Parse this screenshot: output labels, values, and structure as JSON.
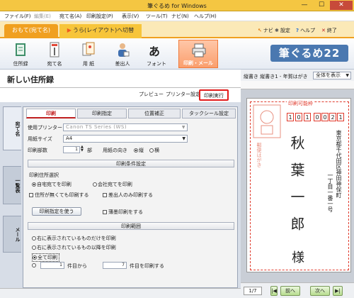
{
  "window": {
    "title": "筆ぐるめ for Windows",
    "min": "—",
    "max": "☐",
    "close": "✕"
  },
  "menu": [
    {
      "label": "ファイル(F)",
      "enabled": true
    },
    {
      "label": "編集(E)",
      "enabled": false
    },
    {
      "label": "宛て名(A)",
      "enabled": true
    },
    {
      "label": "印刷設定(P)",
      "enabled": true
    },
    {
      "label": "表示(V)",
      "enabled": true
    },
    {
      "label": "ツール(T)",
      "enabled": true
    },
    {
      "label": "ナビ(N)",
      "enabled": true
    },
    {
      "label": "ヘルプ(H)",
      "enabled": true
    }
  ],
  "mode": {
    "front": "おもて(宛て名)",
    "back": "うら(レイアウト)へ切替",
    "back_arrow": "▶"
  },
  "help": {
    "navi": "ナビ",
    "settings": "設定",
    "help": "ヘルプ",
    "exit": "終了"
  },
  "toolbar": {
    "address_book": "住所録",
    "address_name": "宛て名",
    "paper": "用 紙",
    "sender": "差出人",
    "font": "フォント",
    "print_mail": "印刷・メール"
  },
  "logo": "筆ぐるめ22",
  "page_title": "新しい住所録",
  "actions": {
    "preview": "プレビュー",
    "printer_settings": "プリンター設定",
    "print_execute": "印刷実行"
  },
  "side_tabs": {
    "address": "宛て名",
    "list": "一覧表",
    "mail": "メール"
  },
  "dialog": {
    "tabs": {
      "print": "印刷",
      "print_spec": "印刷指定",
      "position": "位置補正",
      "tack_seal": "タックシール設定"
    },
    "printer_label": "使用プリンター",
    "printer_value": "Canon TS Series (WS)",
    "paper_size_label": "用紙サイズ",
    "paper_size_value": "A4",
    "copies_label": "印刷部数",
    "copies_value": "1",
    "copies_unit": "部",
    "orientation_label": "用紙の向き",
    "orient_portrait": "縦",
    "orient_landscape": "横",
    "conditions_title": "印刷条件設定",
    "address_select_label": "印刷住所選択",
    "addr_home": "自宅宛てを印刷",
    "addr_company": "会社宛てを印刷",
    "no_address": "住所が無くても印刷する",
    "sender_only": "差出人のみ印刷する",
    "print_spec_btn": "印刷指定を使う",
    "light_print": "薄墨印刷をする",
    "range_title": "印刷範囲",
    "range_right_only": "右に表示されているものだけを印刷",
    "range_right_and_after": "右に表示されているもの以降を印刷",
    "range_all": "全て印刷",
    "range_from_value": "1",
    "range_from_unit": "件目から",
    "range_to_value": "7",
    "range_to_unit": "件目を印刷する"
  },
  "preview": {
    "layout_label": "縦書き 縦書き1 - 年賀はがき",
    "zoom_value": "全体を表示",
    "print_ok": "印刷可能枠",
    "zip_digits": [
      "1",
      "0",
      "1",
      "0",
      "0",
      "2",
      "1"
    ],
    "address_line1": "東京都千代田区神田神保町",
    "address_line2": "一丁目一番一号",
    "name": "秋葉一郎",
    "honorific": "様",
    "stamp_text": "郵便はがき",
    "page": "1/7",
    "prev": "前へ",
    "next": "次へ"
  },
  "colors": {
    "accent": "#f0a020",
    "highlight": "#e21c1c",
    "logo_bg": "#4a78b0"
  }
}
